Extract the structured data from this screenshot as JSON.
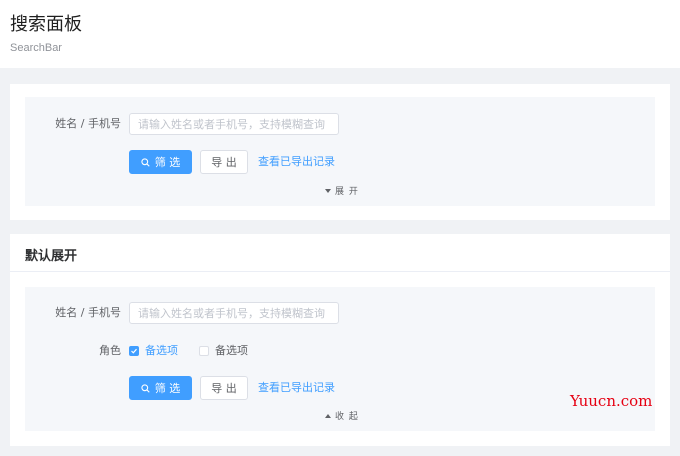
{
  "header": {
    "title": "搜索面板",
    "subtitle": "SearchBar"
  },
  "card1": {
    "field_label": "姓名 / 手机号",
    "input_placeholder": "请输入姓名或者手机号，支持模糊查询",
    "filter_button": "筛 选",
    "export_button": "导 出",
    "view_export_link": "查看已导出记录",
    "toggle_label": "展 开"
  },
  "card2": {
    "title": "默认展开",
    "field_label": "姓名 / 手机号",
    "input_placeholder": "请输入姓名或者手机号，支持模糊查询",
    "role_label": "角色",
    "role_options": [
      {
        "label": "备选项",
        "checked": true
      },
      {
        "label": "备选项",
        "checked": false
      }
    ],
    "filter_button": "筛 选",
    "export_button": "导 出",
    "view_export_link": "查看已导出记录",
    "toggle_label": "收 起"
  },
  "watermark": "Yuucn.com",
  "colors": {
    "primary": "#409eff",
    "watermark": "#e60012"
  }
}
